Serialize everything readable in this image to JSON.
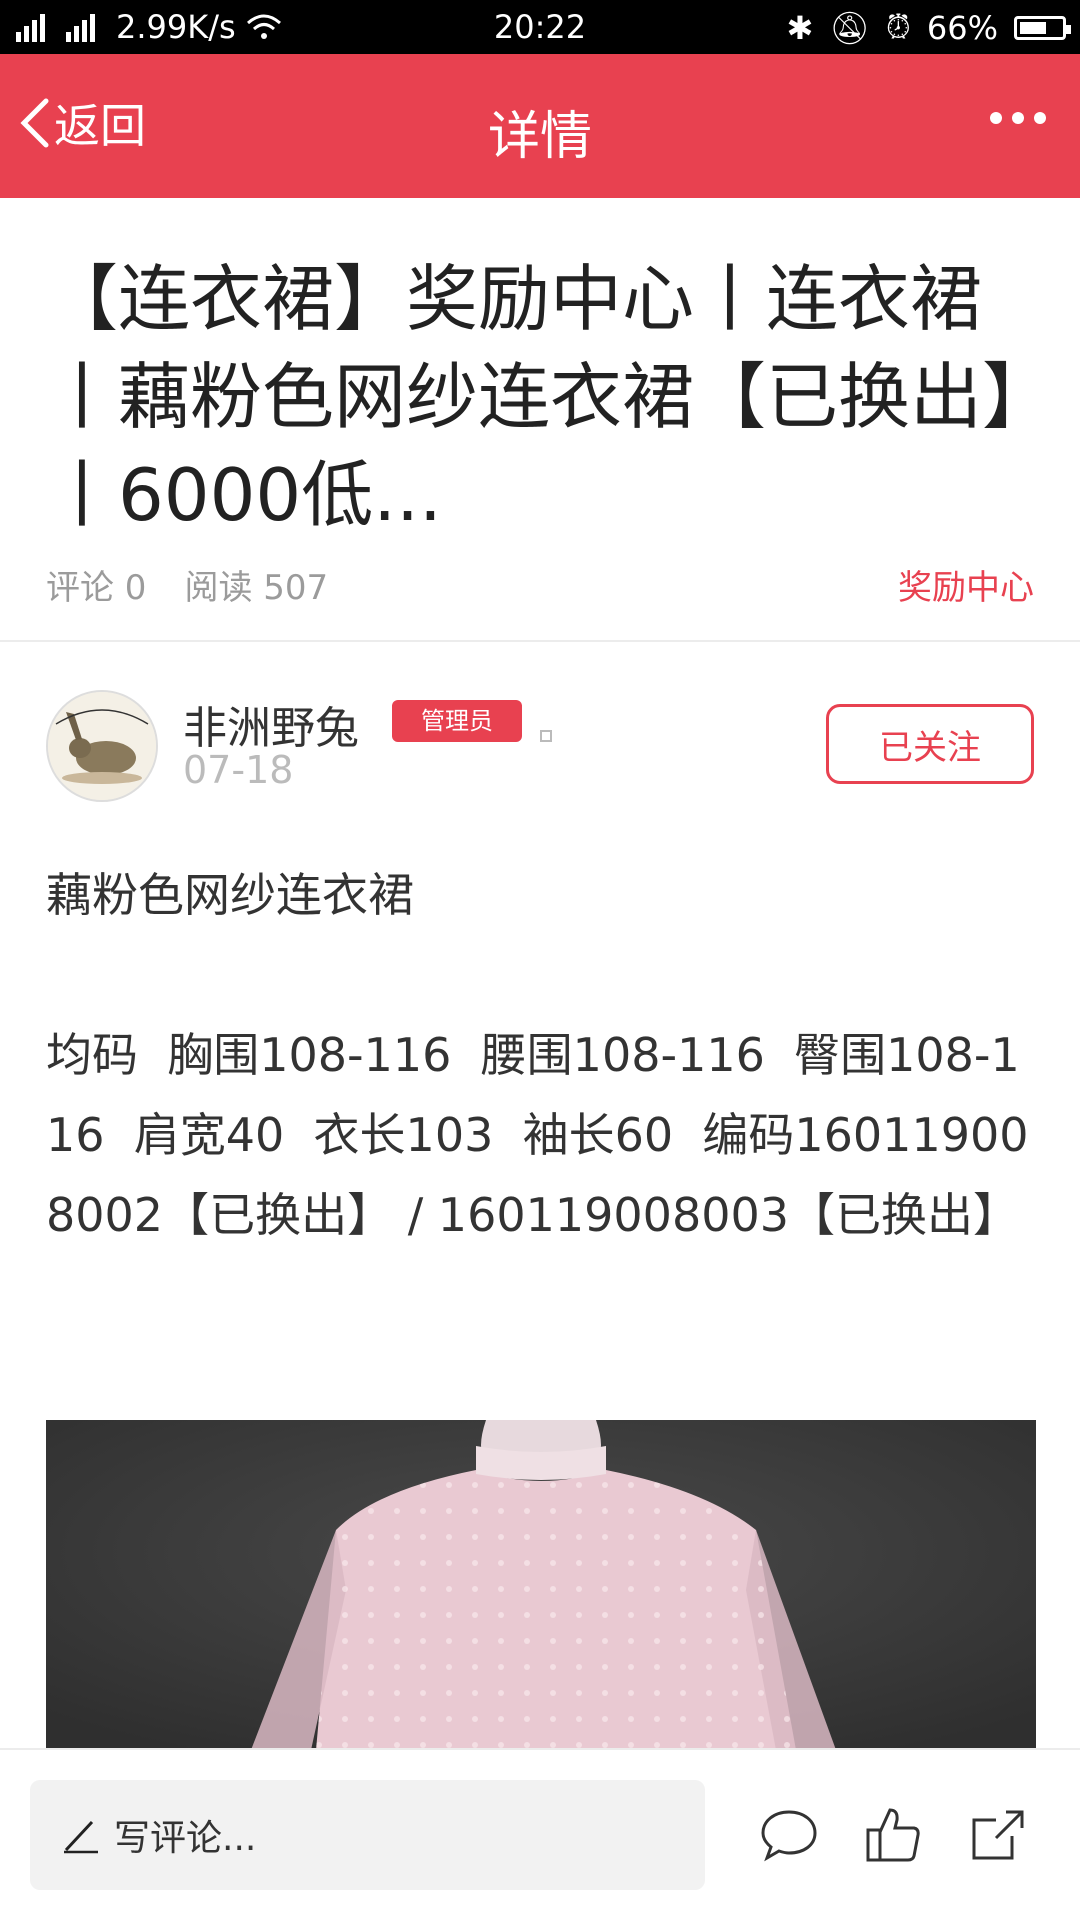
{
  "status_bar": {
    "network": "2.99K/s",
    "time": "20:22",
    "battery": "66%",
    "battery_level": 0.66
  },
  "nav": {
    "back_label": "返回",
    "title": "详情"
  },
  "post": {
    "title": "【连衣裙】奖励中心丨连衣裙丨藕粉色网纱连衣裙【已换出】丨6000低...",
    "comments": "评论 0",
    "reads": "阅读 507",
    "category": "奖励中心",
    "author": {
      "name": "非洲野兔",
      "role": "管理员",
      "date": "07-18",
      "follow_label": "已关注"
    },
    "body": [
      "藕粉色网纱连衣裙",
      "均码  胸围108-116  腰围108-116  臀围108-116  肩宽40  衣长103  袖长60  编码160119008002【已换出】 / 160119008003【已换出】"
    ]
  },
  "bottom_bar": {
    "comment_placeholder": "写评论...",
    "icons": [
      "comment-icon",
      "like-icon",
      "share-icon"
    ]
  },
  "colors": {
    "accent": "#e84150",
    "status_bar": "#000000"
  }
}
